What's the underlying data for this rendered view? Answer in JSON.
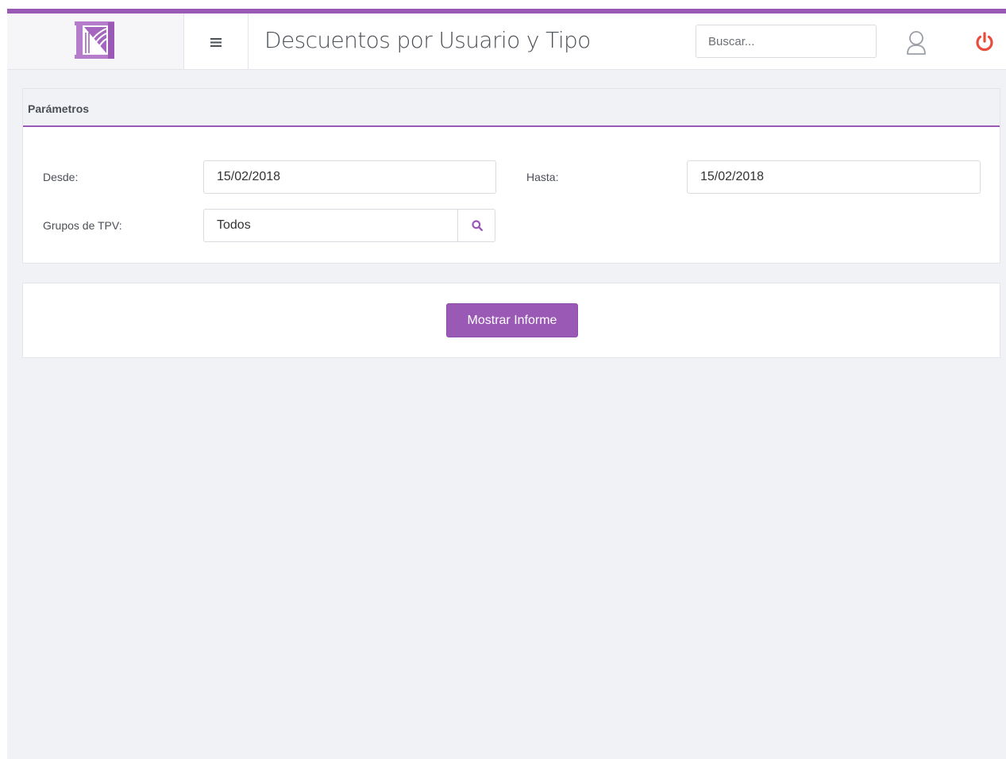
{
  "theme": {
    "accent": "#9b59b6",
    "power": "#e74c3c",
    "background": "#f1f2f6"
  },
  "header": {
    "logo_icon": "bridge-logo-icon",
    "menu_icon": "hamburger-icon",
    "title": "Descuentos por Usuario y Tipo",
    "search_placeholder": "Buscar...",
    "user_icon": "user-icon",
    "power_icon": "power-icon"
  },
  "parameters": {
    "title": "Parámetros",
    "desde_label": "Desde:",
    "desde_value": "15/02/2018",
    "hasta_label": "Hasta:",
    "hasta_value": "15/02/2018",
    "grupos_label": "Grupos de TPV:",
    "grupos_value": "Todos",
    "lookup_icon": "search-icon"
  },
  "actions": {
    "show_report_label": "Mostrar Informe"
  }
}
